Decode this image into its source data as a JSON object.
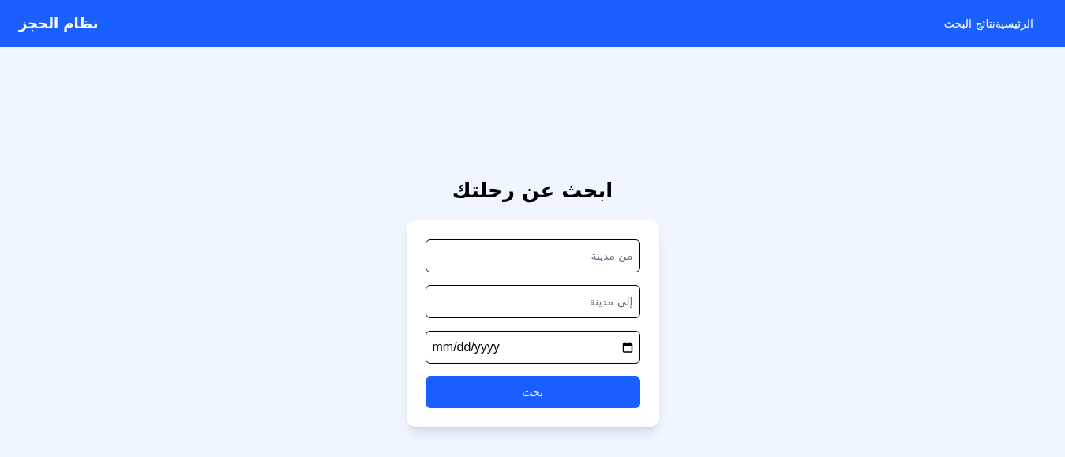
{
  "header": {
    "brand": "نظام الحجز",
    "nav": [
      {
        "label": "الرئيسية"
      },
      {
        "label": "نتائج البحث"
      }
    ]
  },
  "search": {
    "title": "ابحث عن رحلتك",
    "fields": [
      {
        "kind": "text",
        "placeholder": "من مدينة"
      },
      {
        "kind": "text",
        "placeholder": "إلى مدينة"
      },
      {
        "kind": "date",
        "value": "mm/dd/yyyy"
      }
    ],
    "button": "بحث"
  }
}
